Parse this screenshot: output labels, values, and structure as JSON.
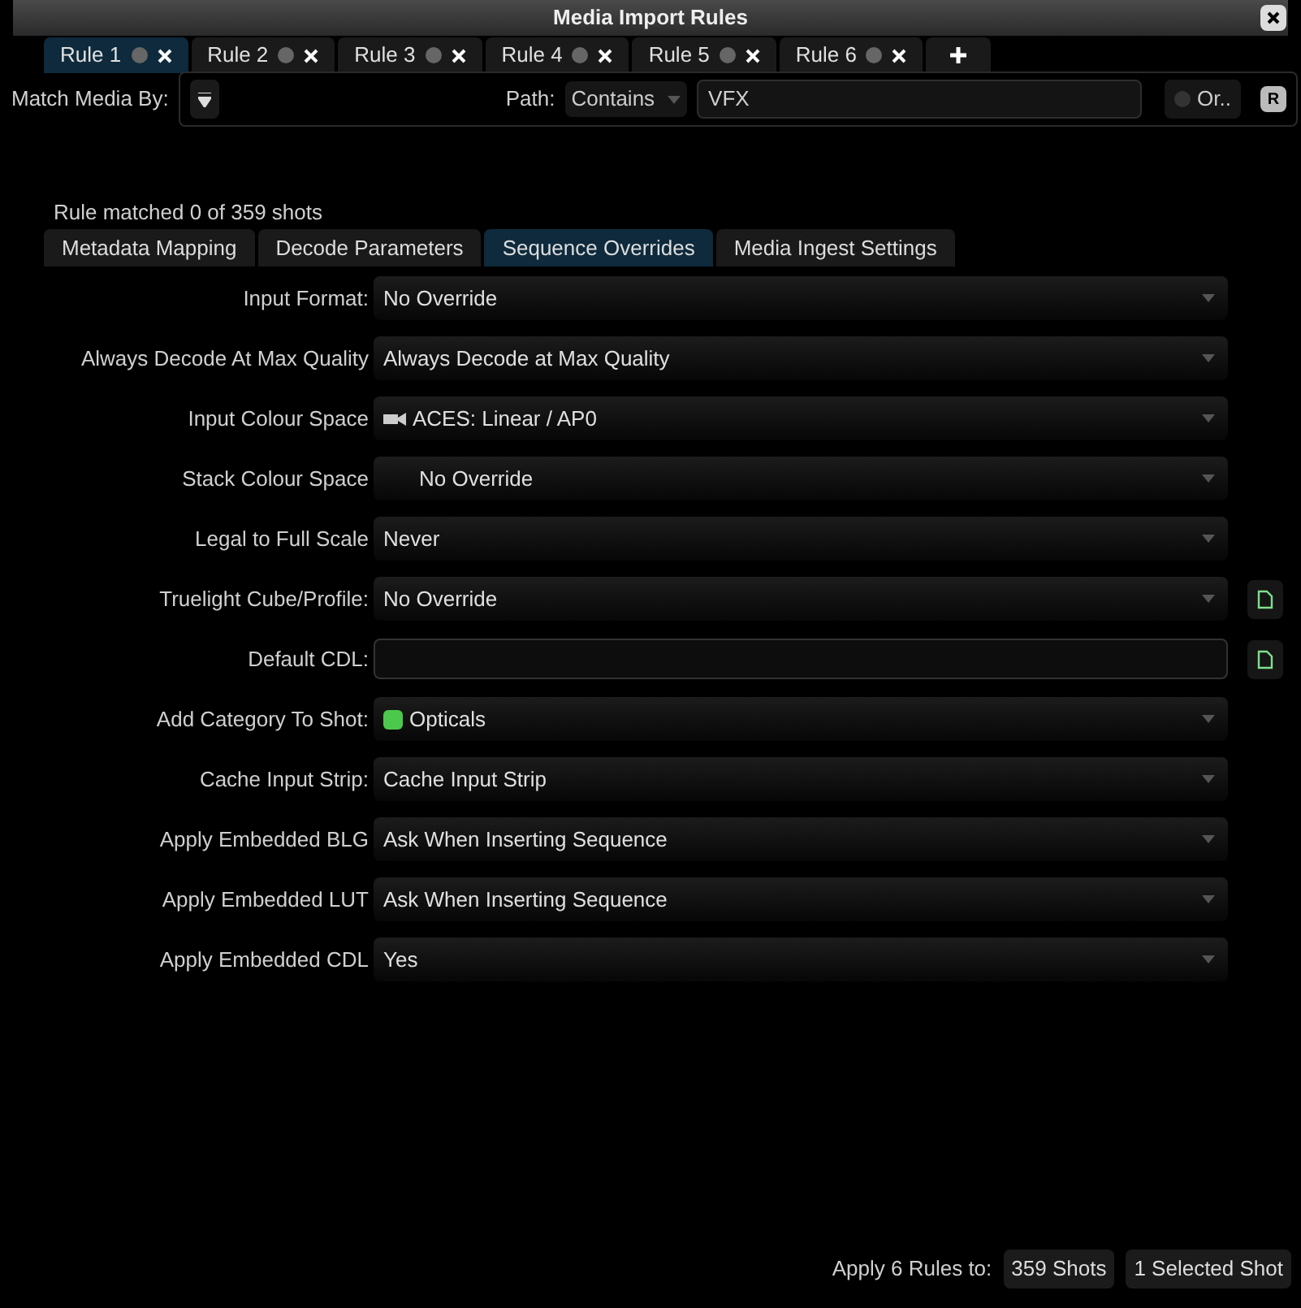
{
  "window": {
    "title": "Media Import Rules"
  },
  "rule_tabs": [
    {
      "label": "Rule 1",
      "selected": true
    },
    {
      "label": "Rule 2",
      "selected": false
    },
    {
      "label": "Rule 3",
      "selected": false
    },
    {
      "label": "Rule 4",
      "selected": false
    },
    {
      "label": "Rule 5",
      "selected": false
    },
    {
      "label": "Rule 6",
      "selected": false
    }
  ],
  "match": {
    "label": "Match Media By:",
    "path_label": "Path:",
    "path_mode": "Contains",
    "path_value": "VFX",
    "or_label": "Or..",
    "r_label": "R"
  },
  "status": "Rule matched 0 of 359 shots",
  "section_tabs": [
    {
      "label": "Metadata Mapping",
      "selected": false
    },
    {
      "label": "Decode Parameters",
      "selected": false
    },
    {
      "label": "Sequence Overrides",
      "selected": true
    },
    {
      "label": "Media Ingest Settings",
      "selected": false
    }
  ],
  "rows": [
    {
      "label": "Input Format:",
      "kind": "dropdown",
      "value": "No Override",
      "file_button": false
    },
    {
      "label": "Always Decode At Max Quality",
      "kind": "dropdown",
      "value": "Always Decode at Max Quality",
      "file_button": false
    },
    {
      "label": "Input Colour Space",
      "kind": "dropdown",
      "value": "ACES: Linear / AP0",
      "camera_icon": true,
      "file_button": false
    },
    {
      "label": "Stack Colour Space",
      "kind": "dropdown",
      "value": "No Override",
      "indented": true,
      "file_button": false
    },
    {
      "label": "Legal to Full Scale",
      "kind": "dropdown",
      "value": "Never",
      "file_button": false
    },
    {
      "label": "Truelight Cube/Profile:",
      "kind": "dropdown",
      "value": "No Override",
      "file_button": true
    },
    {
      "label": "Default CDL:",
      "kind": "text",
      "file_button": true
    },
    {
      "label": "Add Category To Shot:",
      "kind": "dropdown",
      "value": "Opticals",
      "color": "#4cc94c",
      "file_button": false
    },
    {
      "label": "Cache Input Strip:",
      "kind": "dropdown",
      "value": "Cache Input Strip",
      "file_button": false
    },
    {
      "label": "Apply Embedded BLG",
      "kind": "dropdown",
      "value": "Ask When Inserting Sequence",
      "file_button": false
    },
    {
      "label": "Apply Embedded LUT",
      "kind": "dropdown",
      "value": "Ask When Inserting Sequence",
      "file_button": false
    },
    {
      "label": "Apply Embedded CDL",
      "kind": "dropdown",
      "value": "Yes",
      "file_button": false
    }
  ],
  "footer": {
    "label": "Apply 6 Rules to:",
    "buttons": [
      "359 Shots",
      "1 Selected Shot"
    ]
  }
}
